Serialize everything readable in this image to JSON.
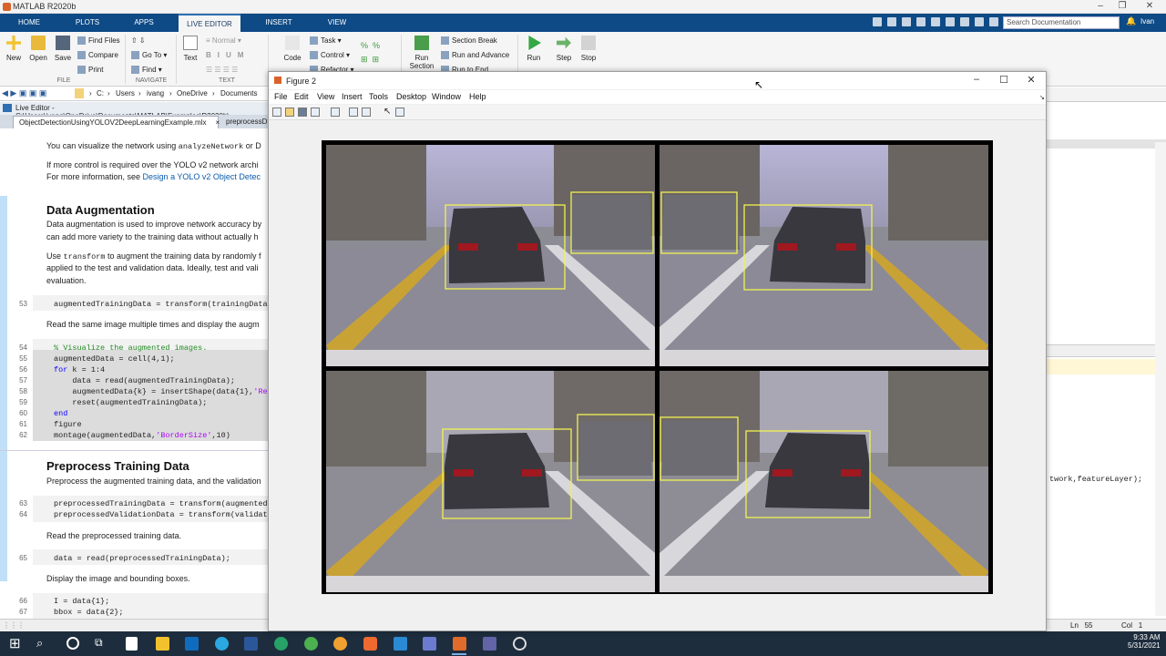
{
  "app": {
    "title": "MATLAB R2020b",
    "user": "Ivan",
    "search_placeholder": "Search Documentation"
  },
  "tabs": [
    "HOME",
    "PLOTS",
    "APPS",
    "LIVE EDITOR",
    "INSERT",
    "VIEW"
  ],
  "ribbon": {
    "new": "New",
    "open": "Open",
    "save": "Save",
    "find_files": "Find Files",
    "compare": "Compare",
    "print": "Print",
    "go_to": "Go To",
    "find": "Find",
    "text": "Text",
    "normal": "Normal",
    "bold": "B",
    "italic": "I",
    "underline": "U",
    "mono": "M",
    "code": "Code",
    "task": "Task",
    "control": "Control",
    "refactor": "Refactor",
    "run_section": "Run",
    "run_section2": "Section",
    "section_break": "Section Break",
    "run_and_advance": "Run and Advance",
    "run_to_end": "Run to End",
    "run": "Run",
    "step": "Step",
    "stop": "Stop",
    "groups": [
      "FILE",
      "NAVIGATE",
      "TEXT"
    ]
  },
  "path": {
    "segments": [
      "C:",
      "Users",
      "ivang",
      "OneDrive",
      "Documents"
    ]
  },
  "live_editor_label": "Live Editor - C:\\Users\\ivang\\OneDrive\\Documents\\MATLAB\\Examples\\R2020b\\",
  "doc_tabs": [
    "ObjectDetectionUsingYOLOV2DeepLearningExample.mlx",
    "preprocessD"
  ],
  "editor": {
    "line1_a": "You can visualize the network using ",
    "line1_code": "analyzeNetwork",
    "line1_b": " or D",
    "line2": "If more control is required over the YOLO v2 network archi",
    "line3_a": "For more information, see ",
    "line3_link": "Design a YOLO v2 Object Detec",
    "heading1": "Data Augmentation",
    "aug1": "Data augmentation is used to improve network accuracy by",
    "aug2": "can add more variety to the training data without actually h",
    "aug3_a": "Use ",
    "aug3_code": "transform",
    "aug3_b": " to augment the training data by randomly f",
    "aug4": "applied to the test and validation data. Ideally, test and vali",
    "aug5": "evaluation.",
    "code53": "augmentedTrainingData = transform(trainingData",
    "read_same": "Read the same image multiple times and display the augm",
    "code54": "% Visualize the augmented images.",
    "code55": "augmentedData = cell(4,1);",
    "code56_kw": "for",
    "code56": " k = 1:4",
    "code57": "    data = read(augmentedTrainingData);",
    "code58_a": "    augmentedData{k} = insertShape(data{1},",
    "code58_str": "'Re",
    "code59": "    reset(augmentedTrainingData);",
    "code60": "end",
    "code61": "figure",
    "code62_a": "montage(augmentedData,",
    "code62_str": "'BorderSize'",
    "code62_b": ",10)",
    "heading2": "Preprocess Training Data",
    "prep1": "Preprocess the augmented training data, and the validation",
    "code63": "preprocessedTrainingData = transform(augmented",
    "code64": "preprocessedValidationData = transform(validat",
    "read_pre": "Read the preprocessed training data.",
    "code65": "data = read(preprocessedTrainingData);",
    "display": "Display the image and bounding boxes.",
    "code66": "I = data{1};",
    "code67": "bbox = data{2};",
    "line_numbers": [
      "53",
      "54",
      "55",
      "56",
      "57",
      "58",
      "59",
      "60",
      "61",
      "62",
      "63",
      "64",
      "65",
      "66",
      "67"
    ]
  },
  "right_pane": {
    "code_snip": "twork,featureLayer);"
  },
  "status": {
    "ln": "Ln",
    "ln_val": "55",
    "col": "Col",
    "col_val": "1"
  },
  "clock": {
    "time": "9:33 AM",
    "date": "5/31/2021"
  },
  "figure": {
    "title": "Figure 2",
    "menu": [
      "File",
      "Edit",
      "View",
      "Insert",
      "Tools",
      "Desktop",
      "Window",
      "Help"
    ]
  },
  "colors": {
    "ribbon_tab_bar": "#0d4a86",
    "bounding_box": "#f2f251",
    "montage_border": "#000000"
  }
}
